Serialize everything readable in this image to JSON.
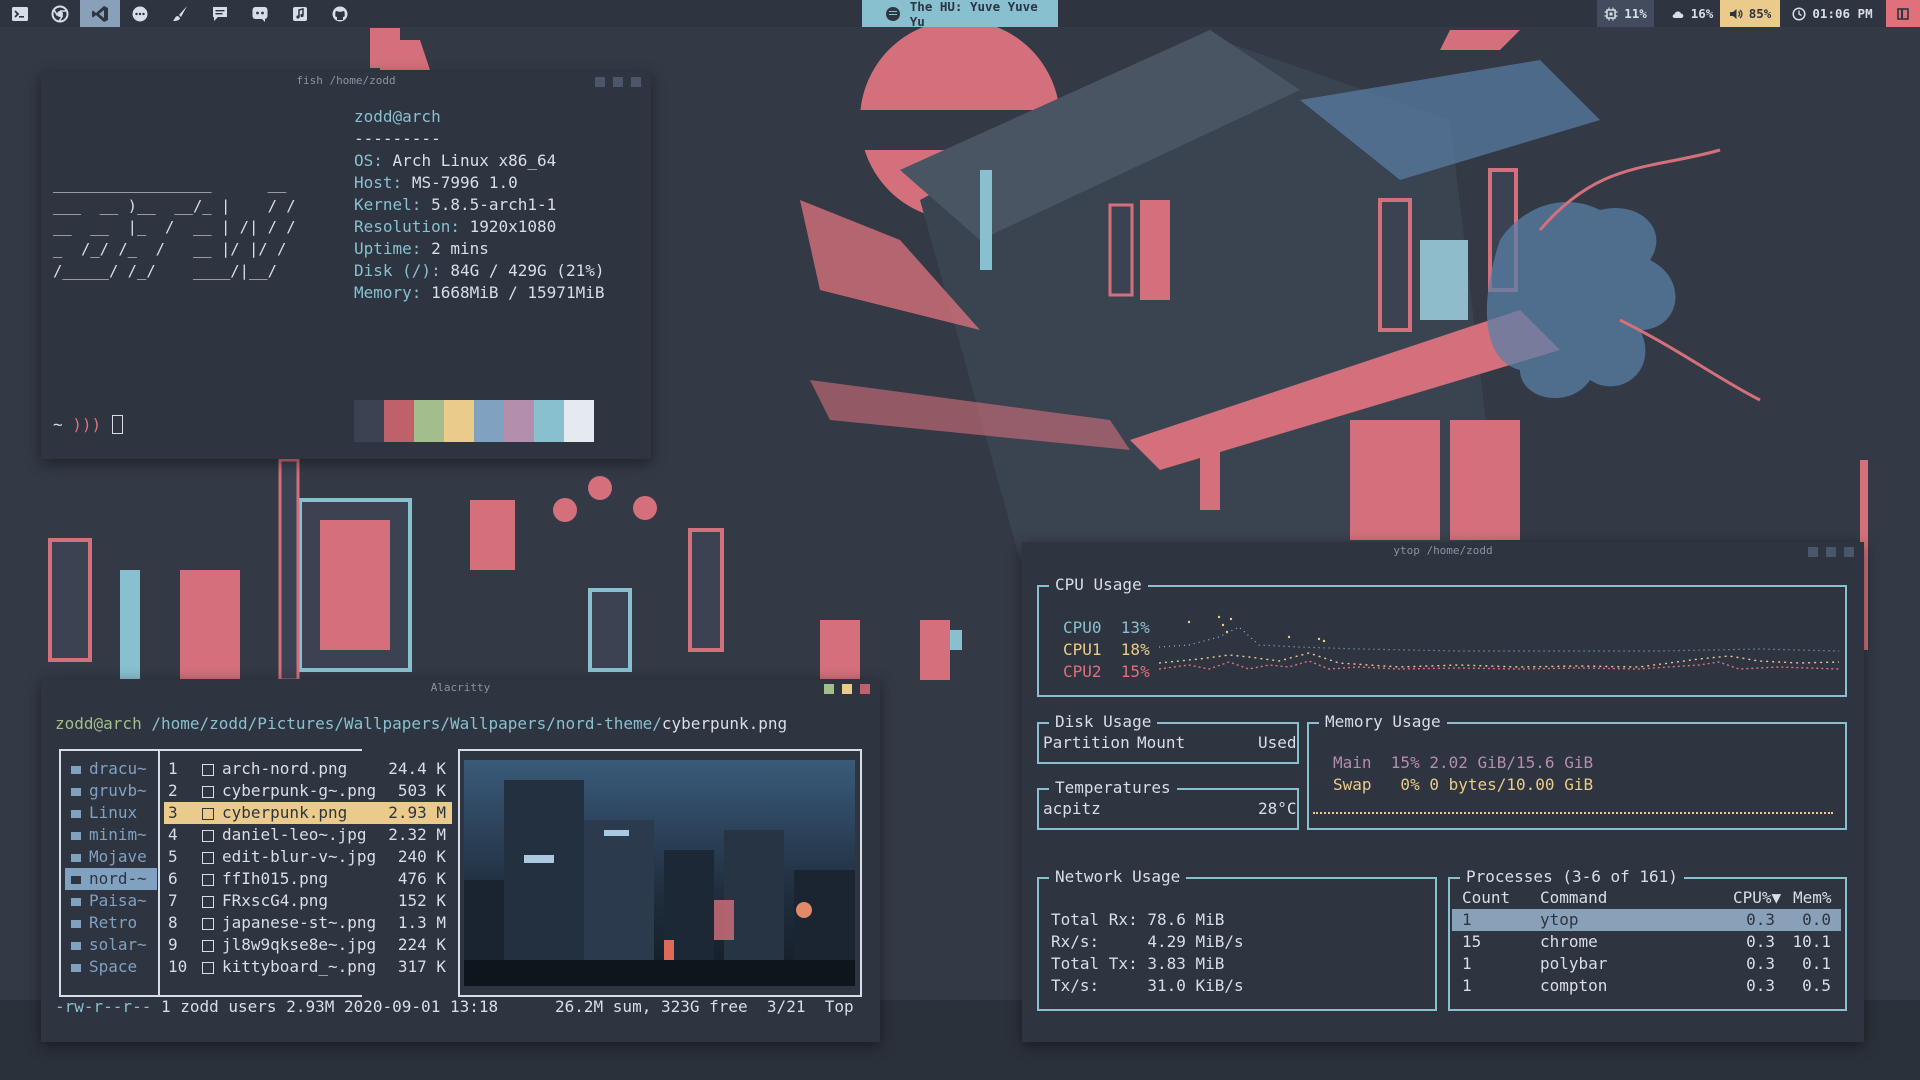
{
  "topbar": {
    "workspaces": [
      {
        "icon": "terminal-icon",
        "active": false
      },
      {
        "icon": "chrome-icon",
        "active": false
      },
      {
        "icon": "vscode-icon",
        "active": true
      },
      {
        "icon": "chat-bubble-icon",
        "active": false
      },
      {
        "icon": "brush-icon",
        "active": false
      },
      {
        "icon": "message-icon",
        "active": false
      },
      {
        "icon": "discord-icon",
        "active": false
      },
      {
        "icon": "music-note-icon",
        "active": false
      },
      {
        "icon": "github-icon",
        "active": false
      }
    ],
    "now_playing": "The HU: Yuve Yuve Yu",
    "cpu": "11%",
    "weather": "16%",
    "volume": "85%",
    "clock": "01:06 PM"
  },
  "fish": {
    "title": "fish /home/zodd",
    "user_host": "zodd@arch",
    "separator": "---------",
    "ascii": [
      "_________________      __",
      "___  __ )__  __/_ |    / /",
      "__  __  |_  /  __ | /| / /",
      "_  /_/ /_  /   __ |/ |/ /",
      "/_____/ /_/    ____/|__/"
    ],
    "info": [
      {
        "label": "OS:",
        "value": "Arch Linux x86_64"
      },
      {
        "label": "Host:",
        "value": "MS-7996 1.0"
      },
      {
        "label": "Kernel:",
        "value": "5.8.5-arch1-1"
      },
      {
        "label": "Resolution:",
        "value": "1920x1080"
      },
      {
        "label": "Uptime:",
        "value": "2 mins"
      },
      {
        "label": "Disk (/):",
        "value": "84G / 429G (21%)"
      },
      {
        "label": "Memory:",
        "value": "1668MiB / 15971MiB"
      }
    ],
    "palette": [
      "#3b4252",
      "#bf616a",
      "#a3be8c",
      "#ebcb8b",
      "#81a1c1",
      "#b48ead",
      "#88c0d0",
      "#e5e9f0"
    ],
    "prompt_tilde": "~",
    "prompt_arrows": ")))"
  },
  "alacritty": {
    "title": "Alacritty",
    "path_user": "zodd@arch",
    "path_dir": "/home/zodd/Pictures/Wallpapers/Wallpapers/nord-theme/",
    "path_file": "cyberpunk.png",
    "folders": [
      "dracu~",
      "gruvb~",
      "Linux",
      "minim~",
      "Mojave",
      "nord-~",
      "Paisa~",
      "Retro",
      "solar~",
      "Space"
    ],
    "selected_folder": 5,
    "files": [
      {
        "n": "1",
        "name": "arch-nord.png",
        "size": "24.4 K"
      },
      {
        "n": "2",
        "name": "cyberpunk-g~.png",
        "size": "503 K"
      },
      {
        "n": "3",
        "name": "cyberpunk.png",
        "size": "2.93 M"
      },
      {
        "n": "4",
        "name": "daniel-leo~.jpg",
        "size": "2.32 M"
      },
      {
        "n": "5",
        "name": "edit-blur-v~.jpg",
        "size": "240 K"
      },
      {
        "n": "6",
        "name": "ffIh015.png",
        "size": "476 K"
      },
      {
        "n": "7",
        "name": "FRxscG4.png",
        "size": "152 K"
      },
      {
        "n": "8",
        "name": "japanese-st~.png",
        "size": "1.3 M"
      },
      {
        "n": "9",
        "name": "jl8w9qkse8e~.jpg",
        "size": "224 K"
      },
      {
        "n": "10",
        "name": "kittyboard_~.png",
        "size": "317 K"
      }
    ],
    "selected_file": 2,
    "status_perms": "-rw-r--r--",
    "status_info": "1 zodd users 2.93M 2020-09-01 13:18",
    "status_right": "26.2M sum, 323G free  3/21  Top"
  },
  "ytop": {
    "title": "ytop /home/zodd",
    "cpu_title": "CPU Usage",
    "cpus": [
      {
        "name": "CPU0",
        "value": "13%"
      },
      {
        "name": "CPU1",
        "value": "18%"
      },
      {
        "name": "CPU2",
        "value": "15%"
      }
    ],
    "disk_title": "Disk Usage",
    "disk_headers": [
      "Partition",
      "Mount",
      "Used"
    ],
    "temp_title": "Temperatures",
    "temp_name": "acpitz",
    "temp_value": "28°C",
    "mem_title": "Memory Usage",
    "mem_main": "Main  15% 2.02 GiB/15.6 GiB",
    "mem_swap": "Swap   0% 0 bytes/10.00 GiB",
    "net_title": "Network Usage",
    "net": [
      {
        "label": "Total Rx:",
        "value": "78.6 MiB"
      },
      {
        "label": "Rx/s:",
        "value": "4.29 MiB/s"
      },
      {
        "label": "Total Tx:",
        "value": "3.83 MiB"
      },
      {
        "label": "Tx/s:",
        "value": "31.0 KiB/s"
      }
    ],
    "proc_title": "Processes (3-6 of 161)",
    "proc_headers": [
      "Count",
      "Command",
      "CPU%▼",
      "Mem%"
    ],
    "procs": [
      {
        "count": "1",
        "cmd": "ytop",
        "cpu": "0.3",
        "mem": "0.0"
      },
      {
        "count": "15",
        "cmd": "chrome",
        "cpu": "0.3",
        "mem": "10.1"
      },
      {
        "count": "1",
        "cmd": "polybar",
        "cpu": "0.3",
        "mem": "0.1"
      },
      {
        "count": "1",
        "cmd": "compton",
        "cpu": "0.3",
        "mem": "0.5"
      }
    ]
  },
  "colors": {
    "bg": "#2e3440",
    "accent": "#88c0d0",
    "pink": "#e0707a",
    "yellow": "#ebcb8b",
    "blue": "#81a1c1"
  }
}
